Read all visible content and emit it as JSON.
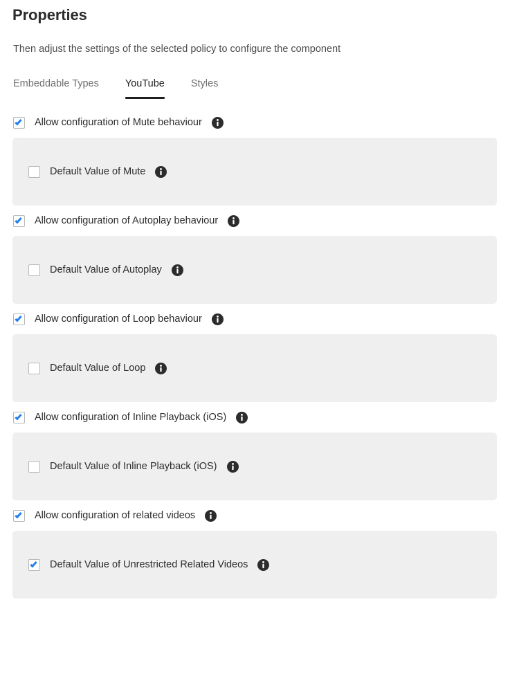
{
  "header": {
    "title": "Properties",
    "subtitle": "Then adjust the settings of the selected policy to configure the component"
  },
  "tabs": [
    {
      "label": "Embeddable Types",
      "active": false
    },
    {
      "label": "YouTube",
      "active": true
    },
    {
      "label": "Styles",
      "active": false
    }
  ],
  "colors": {
    "checkbox_accent": "#2680eb",
    "panel_background": "#efefef",
    "info_icon": "#2c2c2c",
    "text_primary": "#2c2c2c",
    "text_muted": "#6e6e6e",
    "tab_active_underline": "#1f1f1f"
  },
  "icons": {
    "info": "info-icon",
    "checkmark": "check-icon"
  },
  "settings": [
    {
      "allow": {
        "label": "Allow configuration of Mute behaviour",
        "checked": true,
        "info": true
      },
      "default": {
        "label": "Default Value of Mute",
        "checked": false,
        "info": true
      }
    },
    {
      "allow": {
        "label": "Allow configuration of Autoplay behaviour",
        "checked": true,
        "info": true
      },
      "default": {
        "label": "Default Value of Autoplay",
        "checked": false,
        "info": true
      }
    },
    {
      "allow": {
        "label": "Allow configuration of Loop behaviour",
        "checked": true,
        "info": true
      },
      "default": {
        "label": "Default Value of Loop",
        "checked": false,
        "info": true
      }
    },
    {
      "allow": {
        "label": "Allow configuration of Inline Playback (iOS)",
        "checked": true,
        "info": true
      },
      "default": {
        "label": "Default Value of Inline Playback (iOS)",
        "checked": false,
        "info": true
      }
    },
    {
      "allow": {
        "label": "Allow configuration of related videos",
        "checked": true,
        "info": true
      },
      "default": {
        "label": "Default Value of Unrestricted Related Videos",
        "checked": true,
        "info": true
      }
    }
  ]
}
